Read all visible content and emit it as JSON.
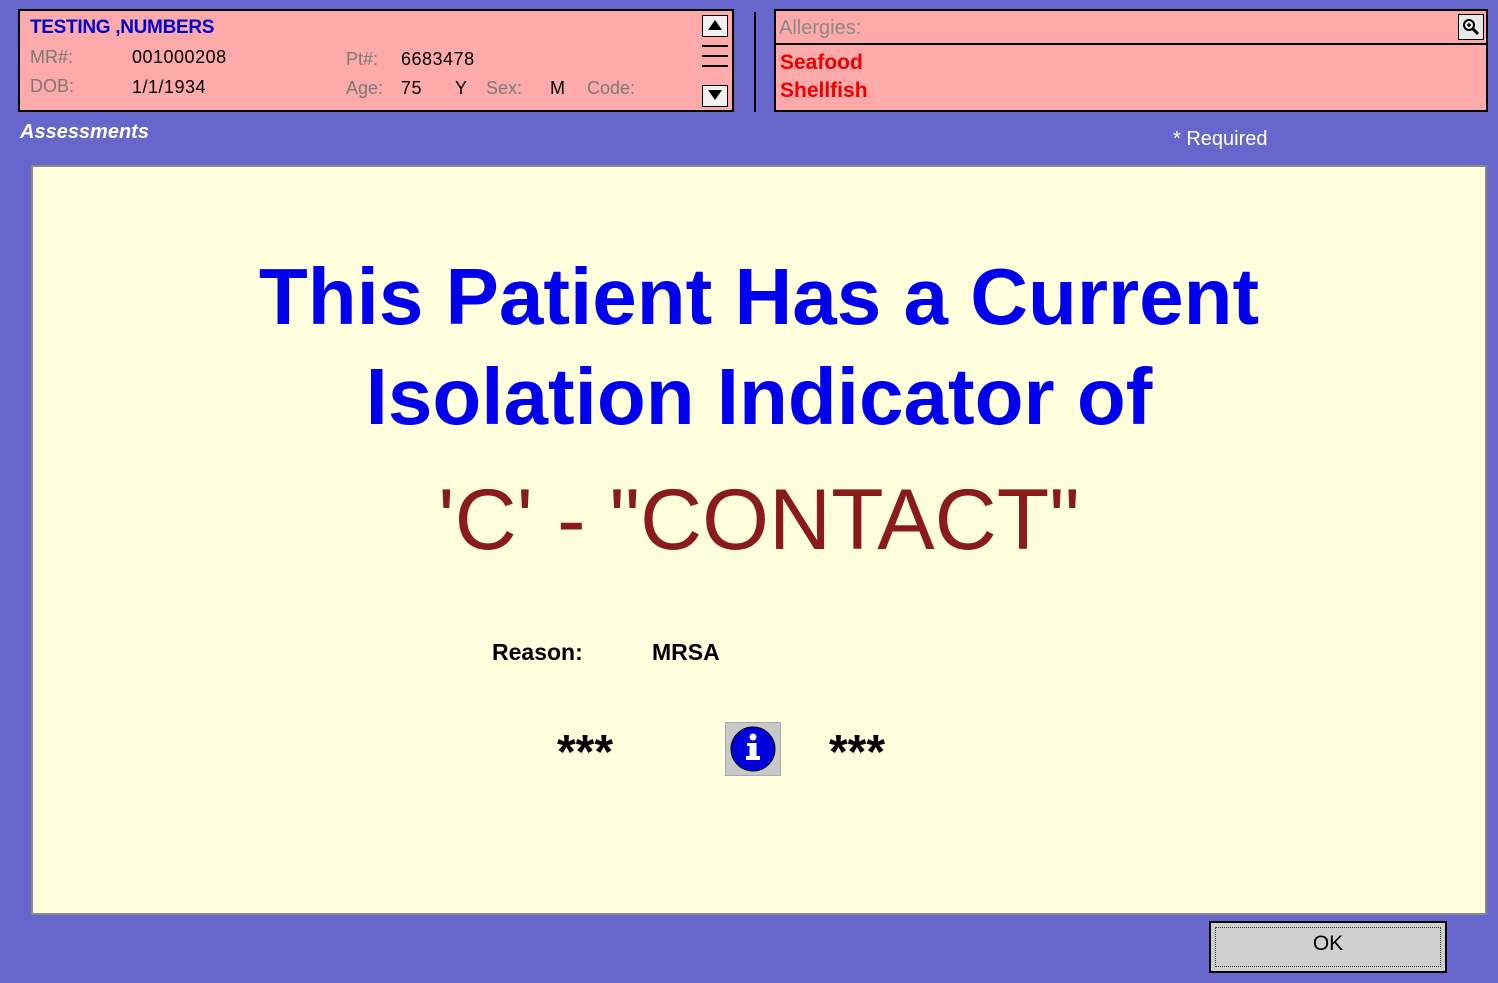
{
  "patient": {
    "name": "TESTING ,NUMBERS",
    "mr_label": "MR#:",
    "mr_value": "001000208",
    "pt_label": "Pt#:",
    "pt_value": "6683478",
    "dob_label": "DOB:",
    "dob_value": "1/1/1934",
    "age_label": "Age:",
    "age_value": "75",
    "age_unit": "Y",
    "sex_label": "Sex:",
    "sex_value": "M",
    "code_label": "Code:"
  },
  "allergies": {
    "title": "Allergies:",
    "items": [
      "Seafood",
      "Shellfish"
    ]
  },
  "section": {
    "title": "Assessments",
    "required_note": "* Required"
  },
  "alert": {
    "line1": "This Patient Has a Current",
    "line2": "Isolation Indicator of",
    "indicator": "'C' - \"CONTACT\"",
    "reason_label": "Reason:",
    "reason_value": "MRSA",
    "stars_left": "***",
    "stars_right": "***"
  },
  "buttons": {
    "ok_label": "OK"
  },
  "colors": {
    "background": "#6666cc",
    "patient_panel": "#ffaaaa",
    "content_bg": "#ffffdd",
    "alert_blue": "#0000ee",
    "indicator_red": "#8b1a1a",
    "allergy_red": "#ee0000"
  }
}
